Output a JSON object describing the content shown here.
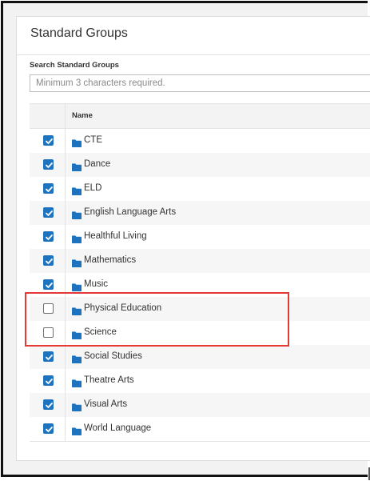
{
  "panel": {
    "title": "Standard Groups"
  },
  "search": {
    "label": "Search Standard Groups",
    "placeholder": "Minimum 3 characters required.",
    "value": ""
  },
  "table": {
    "column_name": "Name",
    "rows": [
      {
        "label": "CTE",
        "checked": true
      },
      {
        "label": "Dance",
        "checked": true
      },
      {
        "label": "ELD",
        "checked": true
      },
      {
        "label": "English Language Arts",
        "checked": true
      },
      {
        "label": "Healthful Living",
        "checked": true
      },
      {
        "label": "Mathematics",
        "checked": true
      },
      {
        "label": "Music",
        "checked": true
      },
      {
        "label": "Physical Education",
        "checked": false
      },
      {
        "label": "Science",
        "checked": false
      },
      {
        "label": "Social Studies",
        "checked": true
      },
      {
        "label": "Theatre Arts",
        "checked": true
      },
      {
        "label": "Visual Arts",
        "checked": true
      },
      {
        "label": "World Language",
        "checked": true
      }
    ]
  },
  "icons": {
    "row_icon": "folder-icon",
    "checkbox_checked_icon": "checkmark-icon"
  },
  "colors": {
    "accent": "#1e73be",
    "highlight": "#e53935",
    "row_stripe": "#f6f6f6"
  }
}
